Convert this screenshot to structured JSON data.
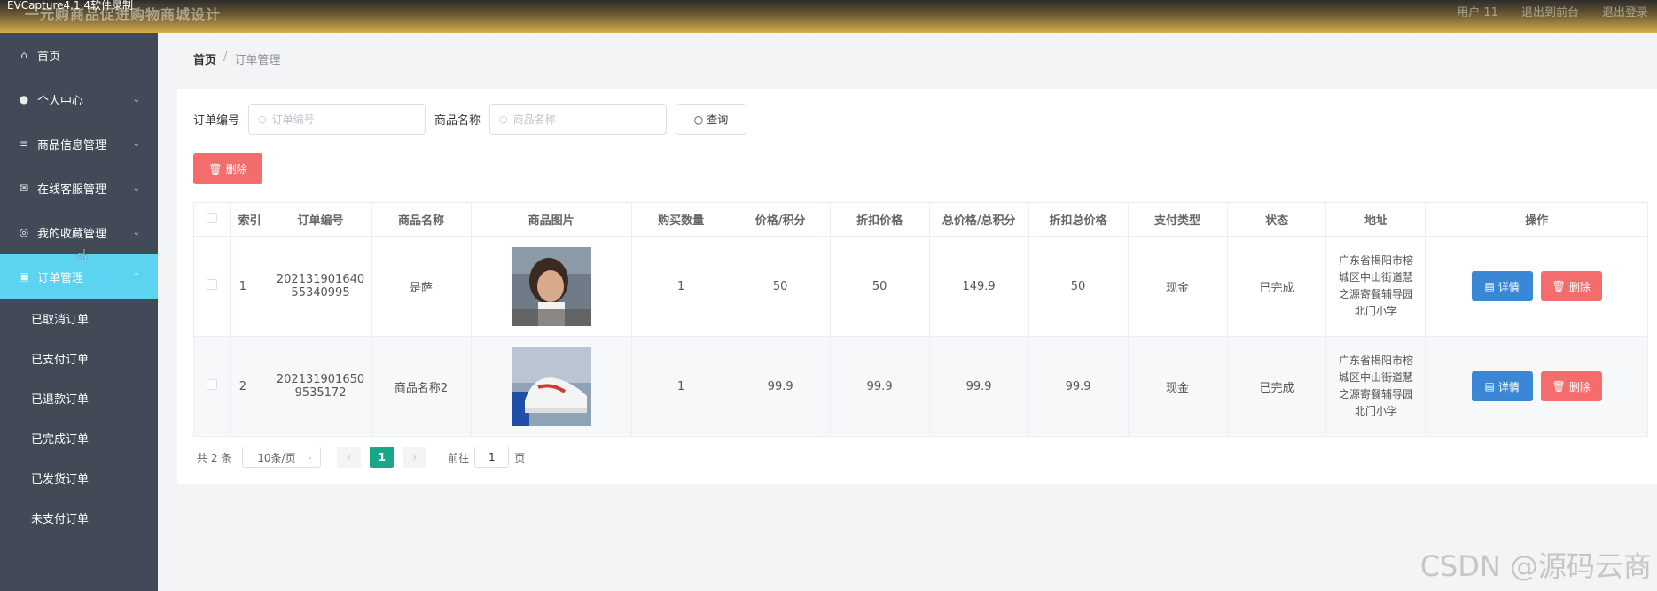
{
  "window": {
    "capture_title": "EVCapture4.1.4软件录制",
    "app_title": "一元购商品促进购物商城设计",
    "user_label": "用户 11",
    "back_label": "退出到前台",
    "logout_label": "退出登录"
  },
  "sidebar": {
    "items": [
      {
        "label": "首页",
        "icon": "home-icon"
      },
      {
        "label": "个人中心",
        "icon": "user-icon"
      },
      {
        "label": "商品信息管理",
        "icon": "sliders-icon"
      },
      {
        "label": "在线客服管理",
        "icon": "mail-icon"
      },
      {
        "label": "我的收藏管理",
        "icon": "compass-icon"
      },
      {
        "label": "订单管理",
        "icon": "briefcase-icon"
      }
    ],
    "subitems": [
      "已取消订单",
      "已支付订单",
      "已退款订单",
      "已完成订单",
      "已发货订单",
      "未支付订单"
    ]
  },
  "breadcrumb": {
    "home": "首页",
    "sep": "/",
    "current": "订单管理"
  },
  "search": {
    "order_label": "订单编号",
    "order_placeholder": "订单编号",
    "goods_label": "商品名称",
    "goods_placeholder": "商品名称",
    "query_label": "查询"
  },
  "toolbar": {
    "delete_label": "删除"
  },
  "table": {
    "headers": [
      "",
      "索引",
      "订单编号",
      "商品名称",
      "商品图片",
      "购买数量",
      "价格/积分",
      "折扣价格",
      "总价格/总积分",
      "折扣总价格",
      "支付类型",
      "状态",
      "地址",
      "操作"
    ],
    "rows": [
      {
        "index": "1",
        "order_no_1": "202131901640",
        "order_no_2": "55340995",
        "goods": "是萨",
        "qty": "1",
        "price": "50",
        "discount": "50",
        "total": "149.9",
        "discount_total": "50",
        "pay": "现金",
        "status": "已完成",
        "addr_1": "广东省揭阳市榕",
        "addr_2": "城区中山街道慧",
        "addr_3": "之源寄餐辅导园",
        "addr_4": "北门小学"
      },
      {
        "index": "2",
        "order_no_1": "202131901650",
        "order_no_2": "9535172",
        "goods": "商品名称2",
        "qty": "1",
        "price": "99.9",
        "discount": "99.9",
        "total": "99.9",
        "discount_total": "99.9",
        "pay": "现金",
        "status": "已完成",
        "addr_1": "广东省揭阳市榕",
        "addr_2": "城区中山街道慧",
        "addr_3": "之源寄餐辅导园",
        "addr_4": "北门小学"
      }
    ],
    "detail_label": "详情",
    "delete_label": "删除"
  },
  "pagination": {
    "total": "共 2 条",
    "page_size": "10条/页",
    "current": "1",
    "goto_label": "前往",
    "goto_value": "1",
    "page_suffix": "页"
  },
  "watermark": "CSDN @源码云商",
  "colors": {
    "sidebar_bg": "#424a57",
    "active": "#5cd3f0",
    "danger": "#f56c6c",
    "primary": "#3a87d6",
    "pager_active": "#17a88a"
  }
}
